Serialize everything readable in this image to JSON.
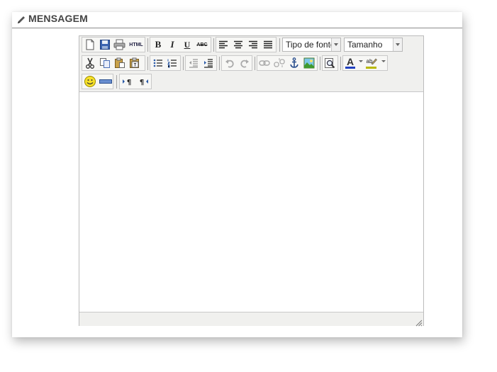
{
  "section": {
    "title": "MENSAGEM",
    "icon": "pencil-icon"
  },
  "toolbar": {
    "html_label": "HTML",
    "bold_label": "B",
    "italic_label": "I",
    "underline_label": "U",
    "strike_label": "ABC",
    "font_family": {
      "value": "Tipo de fonte"
    },
    "font_size": {
      "value": "Tamanho"
    },
    "icons": [
      "new-document-icon",
      "save-icon",
      "print-icon",
      "html-source-icon",
      "bold-icon",
      "italic-icon",
      "underline-icon",
      "strikethrough-icon",
      "align-left-icon",
      "align-center-icon",
      "align-right-icon",
      "align-justify-icon",
      "cut-icon",
      "copy-icon",
      "paste-icon",
      "paste-text-icon",
      "bullet-list-icon",
      "numbered-list-icon",
      "outdent-icon",
      "indent-icon",
      "undo-icon",
      "redo-icon",
      "link-icon",
      "unlink-icon",
      "anchor-icon",
      "image-icon",
      "preview-icon",
      "text-color-icon",
      "highlight-color-icon",
      "emoticon-icon",
      "horizontal-rule-icon",
      "ltr-icon",
      "rtl-icon"
    ]
  },
  "colors": {
    "accent_blue": "#2a5aa8",
    "text_color_bar": "#2040c0",
    "highlight_bar": "#b8b800"
  },
  "editor": {
    "content": ""
  }
}
